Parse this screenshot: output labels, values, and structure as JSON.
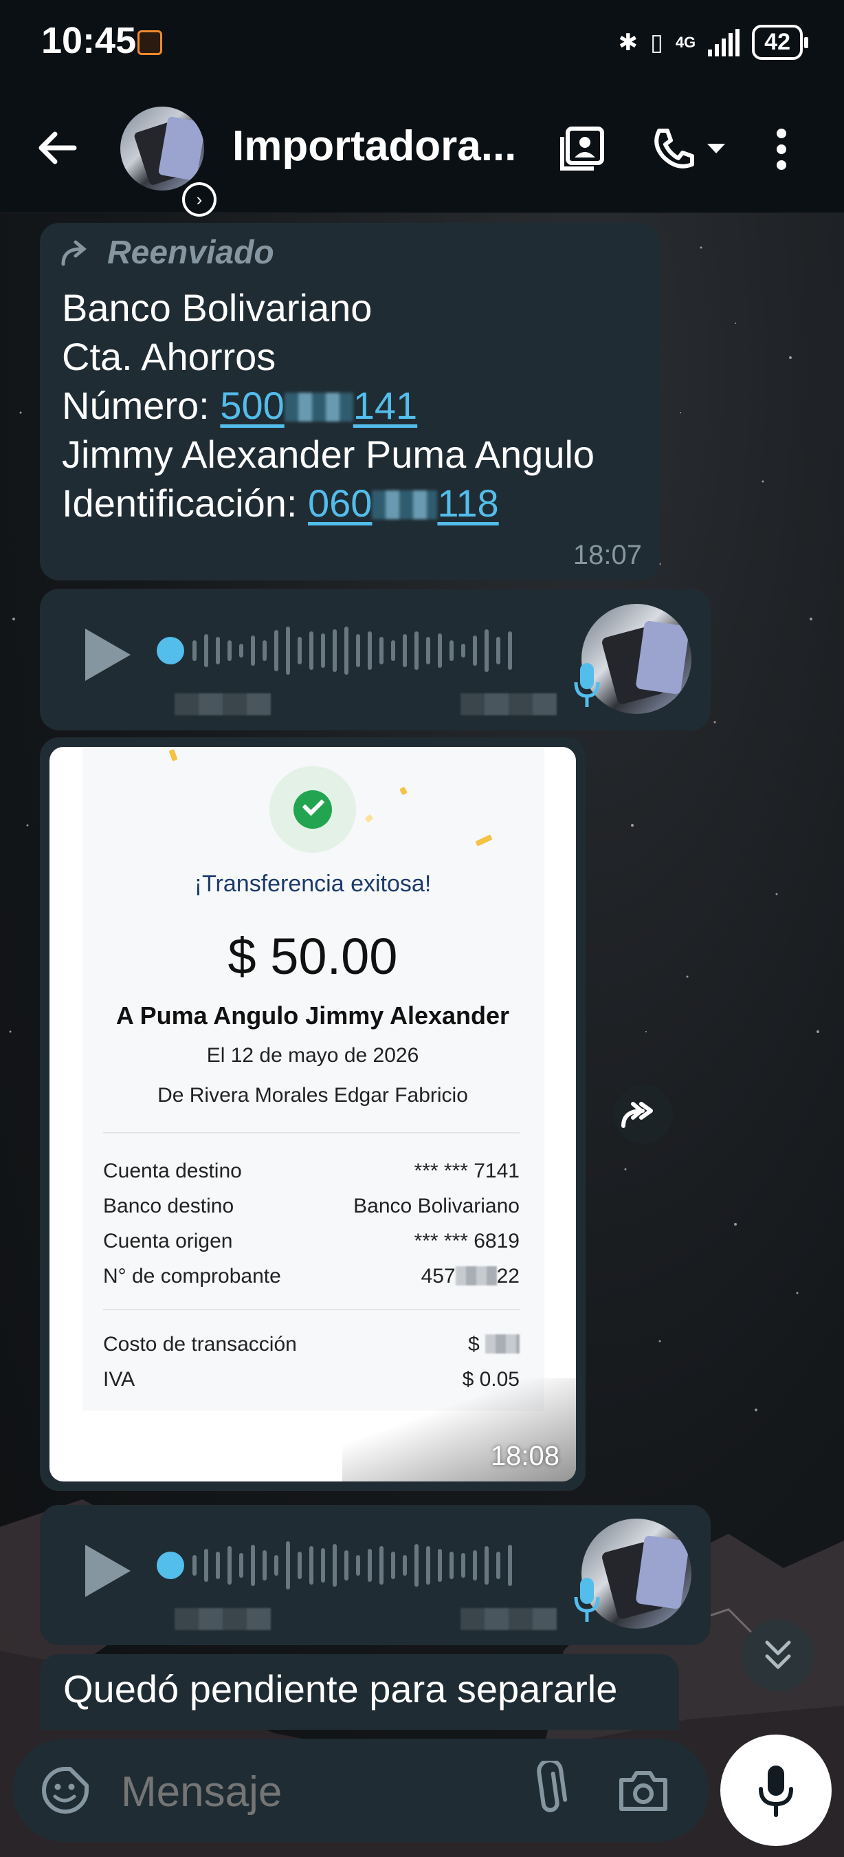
{
  "status_bar": {
    "time": "10:45",
    "battery": "42",
    "network": "4G"
  },
  "header": {
    "title": "Importadora..."
  },
  "messages": {
    "forwarded": {
      "forward_label": "Reenviado",
      "line1": "Banco Bolivariano",
      "line2": "Cta. Ahorros",
      "account_label": "Número: ",
      "account_prefix": "500",
      "account_suffix": "141",
      "name": "Jimmy Alexander Puma Angulo",
      "id_label": "Identificación: ",
      "id_prefix": "060",
      "id_suffix": "118",
      "time": "18:07"
    },
    "receipt": {
      "title": "¡Transferencia exitosa!",
      "amount": "$ 50.00",
      "to": "A Puma Angulo Jimmy Alexander",
      "date": "El 12 de mayo de 2026",
      "from": "De Rivera Morales Edgar Fabricio",
      "rows": [
        {
          "label": "Cuenta destino",
          "value": "*** *** 7141"
        },
        {
          "label": "Banco destino",
          "value": "Banco Bolivariano"
        },
        {
          "label": "Cuenta origen",
          "value": "*** *** 6819"
        },
        {
          "label": "N° de comprobante",
          "value_prefix": "457",
          "value_suffix": "22"
        }
      ],
      "fees": [
        {
          "label": "Costo de transacción",
          "value_prefix": "$"
        },
        {
          "label": "IVA",
          "value": "$ 0.05"
        }
      ],
      "time": "18:08"
    },
    "last_message": "Quedó pendiente para separarle"
  },
  "input": {
    "placeholder": "Mensaje"
  },
  "icons": {
    "back": "arrow-left-icon",
    "gallery": "contact-card-icon",
    "call": "phone-icon",
    "menu": "more-vert-icon",
    "emoji": "sticker-icon",
    "attach": "paperclip-icon",
    "camera": "camera-icon",
    "mic": "mic-icon",
    "share": "forward-icon",
    "scroll": "double-chevron-down-icon"
  },
  "colors": {
    "accent": "#53bdeb",
    "bubble": "#202c33",
    "header": "#0b1014",
    "check": "#23a450",
    "receipt_title": "#1b3a6b"
  }
}
